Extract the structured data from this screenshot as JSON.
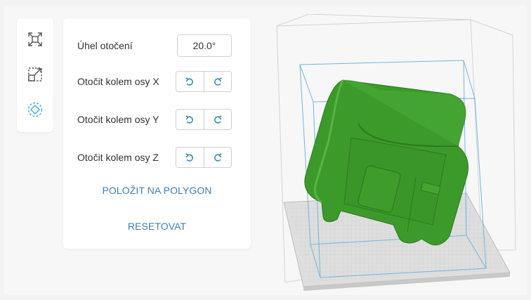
{
  "rotation_panel": {
    "angle_label": "Úhel otočení",
    "angle_value": "20.0°",
    "axis_x_label": "Otočit kolem osy X",
    "axis_y_label": "Otočit kolem osy Y",
    "axis_z_label": "Otočit kolem osy Z",
    "lay_on_face_label": "POLOŽIT NA POLYGON",
    "reset_label": "RESETOVAT"
  },
  "toolbar": {
    "tools": [
      "fit-to-screen-icon",
      "scale-icon",
      "rotate-icon"
    ],
    "active_tool": "rotate-icon"
  },
  "colors": {
    "accent": "#3ea8e0",
    "link": "#3b7fb6",
    "model": "#3c9a2a"
  }
}
